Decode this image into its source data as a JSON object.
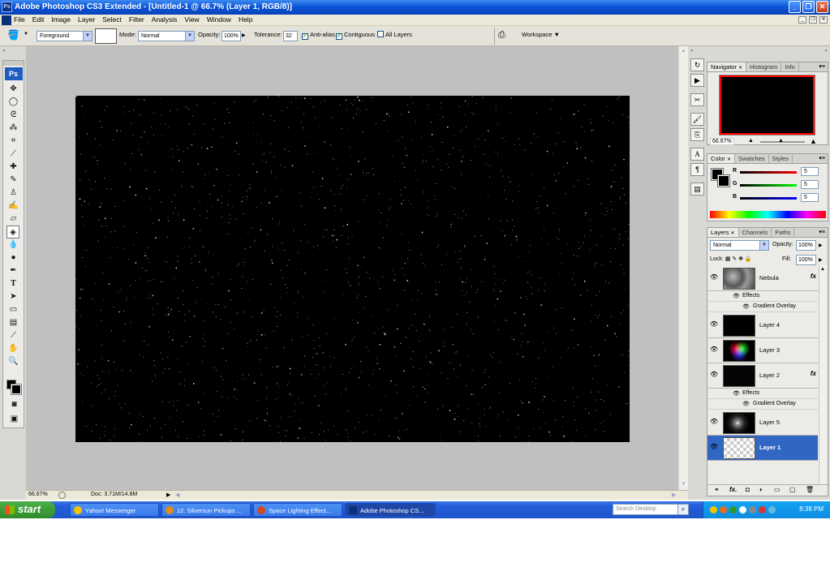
{
  "window": {
    "app_icon": "Ps",
    "title": "Adobe Photoshop CS3 Extended - [Untitled-1 @ 66.7% (Layer 1, RGB/8)]"
  },
  "menu": [
    "File",
    "Edit",
    "Image",
    "Layer",
    "Select",
    "Filter",
    "Analysis",
    "View",
    "Window",
    "Help"
  ],
  "options": {
    "fill_source": "Foreground",
    "mode_label": "Mode:",
    "mode_value": "Normal",
    "opacity_label": "Opacity:",
    "opacity_value": "100%",
    "tolerance_label": "Tolerance:",
    "tolerance_value": "32",
    "anti_alias_label": "Anti-alias",
    "contiguous_label": "Contiguous",
    "all_layers_label": "All Layers",
    "workspace_label": "Workspace"
  },
  "toolbox": {
    "logo": "Ps"
  },
  "status": {
    "zoom": "66.67%",
    "doc": "Doc: 3.71M/14.8M"
  },
  "navigator": {
    "tabs": [
      "Navigator",
      "Histogram",
      "Info"
    ],
    "zoom": "66.67%"
  },
  "color_panel": {
    "tabs": [
      "Color",
      "Swatches",
      "Styles"
    ],
    "channels": [
      {
        "label": "R",
        "value": "5"
      },
      {
        "label": "G",
        "value": "5"
      },
      {
        "label": "B",
        "value": "5"
      }
    ]
  },
  "layers_panel": {
    "tabs": [
      "Layers",
      "Channels",
      "Paths"
    ],
    "blend_mode": "Normal",
    "opacity_label": "Opacity:",
    "opacity_value": "100%",
    "lock_label": "Lock:",
    "fill_label": "Fill:",
    "fill_value": "100%",
    "effects_label": "Effects",
    "gradient_overlay_label": "Gradient Overlay",
    "layers": [
      {
        "name": "Nebula",
        "fx": "fx"
      },
      {
        "name": "Layer 4"
      },
      {
        "name": "Layer 3"
      },
      {
        "name": "Layer 2",
        "fx": "fx"
      },
      {
        "name": "Layer 5"
      },
      {
        "name": "Layer 1"
      }
    ]
  },
  "taskbar": {
    "start": "start",
    "tasks": [
      "Yahoo! Messenger",
      "12. Silversun Pickups ...",
      "Space Lighting Effect...",
      "Adobe Photoshop CS..."
    ],
    "search_placeholder": "Search Desktop",
    "clock": "8:38 PM"
  },
  "colors": {
    "title_bar": "#0a55d8",
    "selection": "#3166c4",
    "workspace": "#c0c0c0",
    "navigator_view": "#ff0000"
  }
}
